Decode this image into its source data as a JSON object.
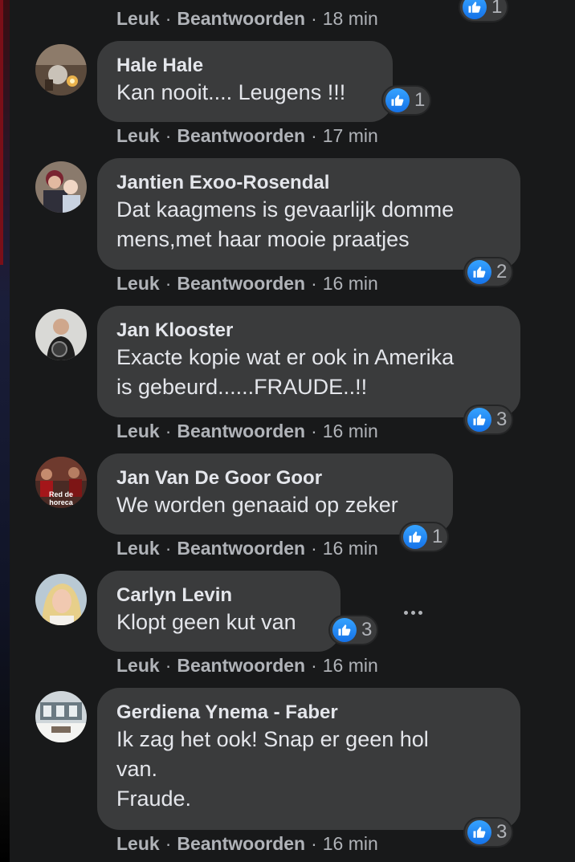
{
  "labels": {
    "like": "Leuk",
    "reply": "Beantwoorden",
    "separator": "·"
  },
  "colors": {
    "background": "#18191a",
    "bubble": "#3a3b3c",
    "like_blue": "#1877f2",
    "secondary_text": "#b0b3b8"
  },
  "top_partial": {
    "time": "18 min",
    "reaction_count": "1"
  },
  "comments": [
    {
      "author": "Hale Hale",
      "lines": [
        "Kan nooit.... Leugens !!!"
      ],
      "reaction_count": "1",
      "time": "17 min"
    },
    {
      "author": "Jantien Exoo-Rosendal",
      "lines": [
        "Dat kaagmens is gevaarlijk domme",
        "mens,met haar mooie praatjes"
      ],
      "reaction_count": "2",
      "time": "16 min"
    },
    {
      "author": "Jan Klooster",
      "lines": [
        "Exacte kopie wat er ook in Amerika",
        "is gebeurd......FRAUDE..!!"
      ],
      "reaction_count": "3",
      "time": "16 min"
    },
    {
      "author": "Jan Van De Goor Goor",
      "lines": [
        "We worden genaaid op zeker"
      ],
      "reaction_count": "1",
      "time": "16 min",
      "avatar_text": [
        "Red de",
        "horeca"
      ]
    },
    {
      "author": "Carlyn Levin",
      "lines": [
        "Klopt geen kut van"
      ],
      "reaction_count": "3",
      "time": "16 min"
    },
    {
      "author": "Gerdiena Ynema - Faber",
      "lines": [
        "Ik zag het ook! Snap er geen hol",
        "van.",
        "Fraude."
      ],
      "reaction_count": "3",
      "time": "16 min"
    }
  ]
}
